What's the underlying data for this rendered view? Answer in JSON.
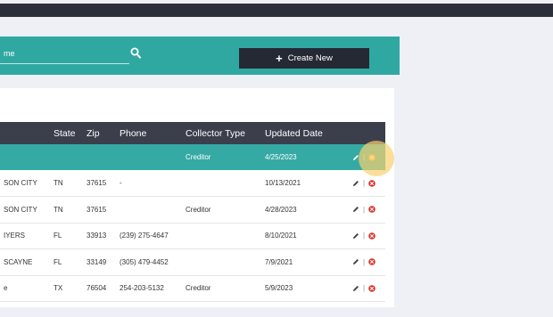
{
  "toolbar": {
    "search_value": "me",
    "create_label": "Create New",
    "color": "#30a8a2"
  },
  "table": {
    "columns": [
      "",
      "State",
      "Zip",
      "Phone",
      "Collector Type",
      "Updated Date",
      ""
    ],
    "rows": [
      {
        "city": "",
        "state": "",
        "zip": "",
        "phone": "",
        "type": "Creditor",
        "date": "4/25/2023",
        "highlight": true
      },
      {
        "city": "SON CITY",
        "state": "TN",
        "zip": "37615",
        "phone": "-",
        "type": "",
        "date": "10/13/2021"
      },
      {
        "city": "SON CITY",
        "state": "TN",
        "zip": "37615",
        "phone": "",
        "type": "Creditor",
        "date": "4/28/2023"
      },
      {
        "city": "IYERS",
        "state": "FL",
        "zip": "33913",
        "phone": "(239) 275-4647",
        "type": "",
        "date": "8/10/2021"
      },
      {
        "city": "SCAYNE",
        "state": "FL",
        "zip": "33149",
        "phone": "(305) 479-4452",
        "type": "",
        "date": "7/9/2021"
      },
      {
        "city": "e",
        "state": "TX",
        "zip": "76504",
        "phone": "254-203-5132",
        "type": "Creditor",
        "date": "5/9/2023"
      }
    ],
    "action_separator": "|",
    "icons": {
      "edit": "pencil-icon",
      "delete": "delete-circle-icon"
    },
    "delete_color": "#d9342b"
  }
}
